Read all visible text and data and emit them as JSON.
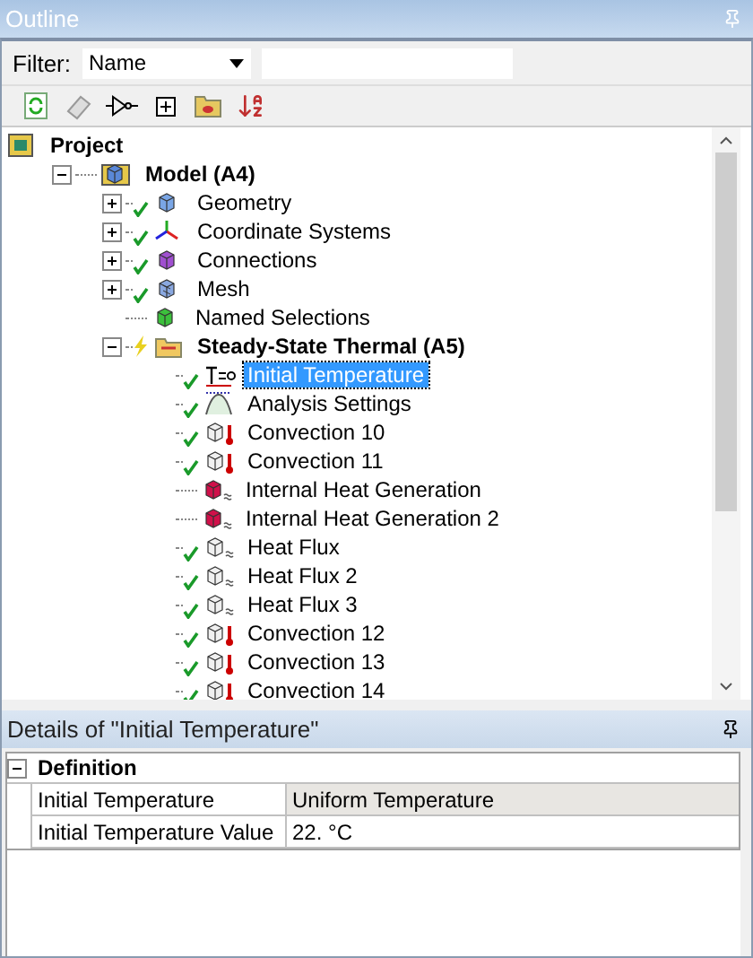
{
  "outline": {
    "title": "Outline",
    "filter": {
      "label": "Filter:",
      "value": "Name"
    },
    "tree": [
      {
        "label": "Project",
        "kind": "project",
        "checked": false,
        "selected": false,
        "children": [
          {
            "label": "Model (A4)",
            "kind": "model",
            "checked": false,
            "selected": false,
            "expanded": true,
            "children": [
              {
                "label": "Geometry",
                "kind": "geometry",
                "checked": true,
                "selected": false,
                "expanded": false
              },
              {
                "label": "Coordinate Systems",
                "kind": "coordinates",
                "checked": true,
                "selected": false,
                "expanded": false
              },
              {
                "label": "Connections",
                "kind": "connections",
                "checked": true,
                "selected": false,
                "expanded": false
              },
              {
                "label": "Mesh",
                "kind": "mesh",
                "checked": true,
                "selected": false,
                "expanded": false
              },
              {
                "label": "Named Selections",
                "kind": "named",
                "checked": false,
                "selected": false
              },
              {
                "label": "Steady-State Thermal (A5)",
                "kind": "analysis",
                "checked": false,
                "selected": false,
                "expanded": true,
                "children": [
                  {
                    "label": "Initial Temperature",
                    "kind": "initial",
                    "checked": true,
                    "selected": true
                  },
                  {
                    "label": "Analysis Settings",
                    "kind": "settings",
                    "checked": true,
                    "selected": false
                  },
                  {
                    "label": "Convection 10",
                    "kind": "convection",
                    "checked": true,
                    "selected": false
                  },
                  {
                    "label": "Convection 11",
                    "kind": "convection",
                    "checked": true,
                    "selected": false
                  },
                  {
                    "label": "Internal Heat Generation",
                    "kind": "generation",
                    "checked": false,
                    "selected": false
                  },
                  {
                    "label": "Internal Heat Generation 2",
                    "kind": "generation",
                    "checked": false,
                    "selected": false
                  },
                  {
                    "label": "Heat Flux",
                    "kind": "flux",
                    "checked": true,
                    "selected": false
                  },
                  {
                    "label": "Heat Flux 2",
                    "kind": "flux",
                    "checked": true,
                    "selected": false
                  },
                  {
                    "label": "Heat Flux 3",
                    "kind": "flux",
                    "checked": true,
                    "selected": false
                  },
                  {
                    "label": "Convection 12",
                    "kind": "convection",
                    "checked": true,
                    "selected": false
                  },
                  {
                    "label": "Convection 13",
                    "kind": "convection",
                    "checked": true,
                    "selected": false
                  },
                  {
                    "label": "Convection 14",
                    "kind": "convection",
                    "checked": true,
                    "selected": false
                  }
                ]
              }
            ]
          }
        ]
      }
    ]
  },
  "details": {
    "title": "Details of \"Initial Temperature\"",
    "sections": [
      {
        "label": "Definition",
        "expanded": true,
        "rows": [
          {
            "name": "Initial Temperature",
            "value": "Uniform Temperature",
            "editable": false
          },
          {
            "name": "Initial Temperature Value",
            "value": "22. °C",
            "editable": true
          }
        ]
      }
    ]
  }
}
